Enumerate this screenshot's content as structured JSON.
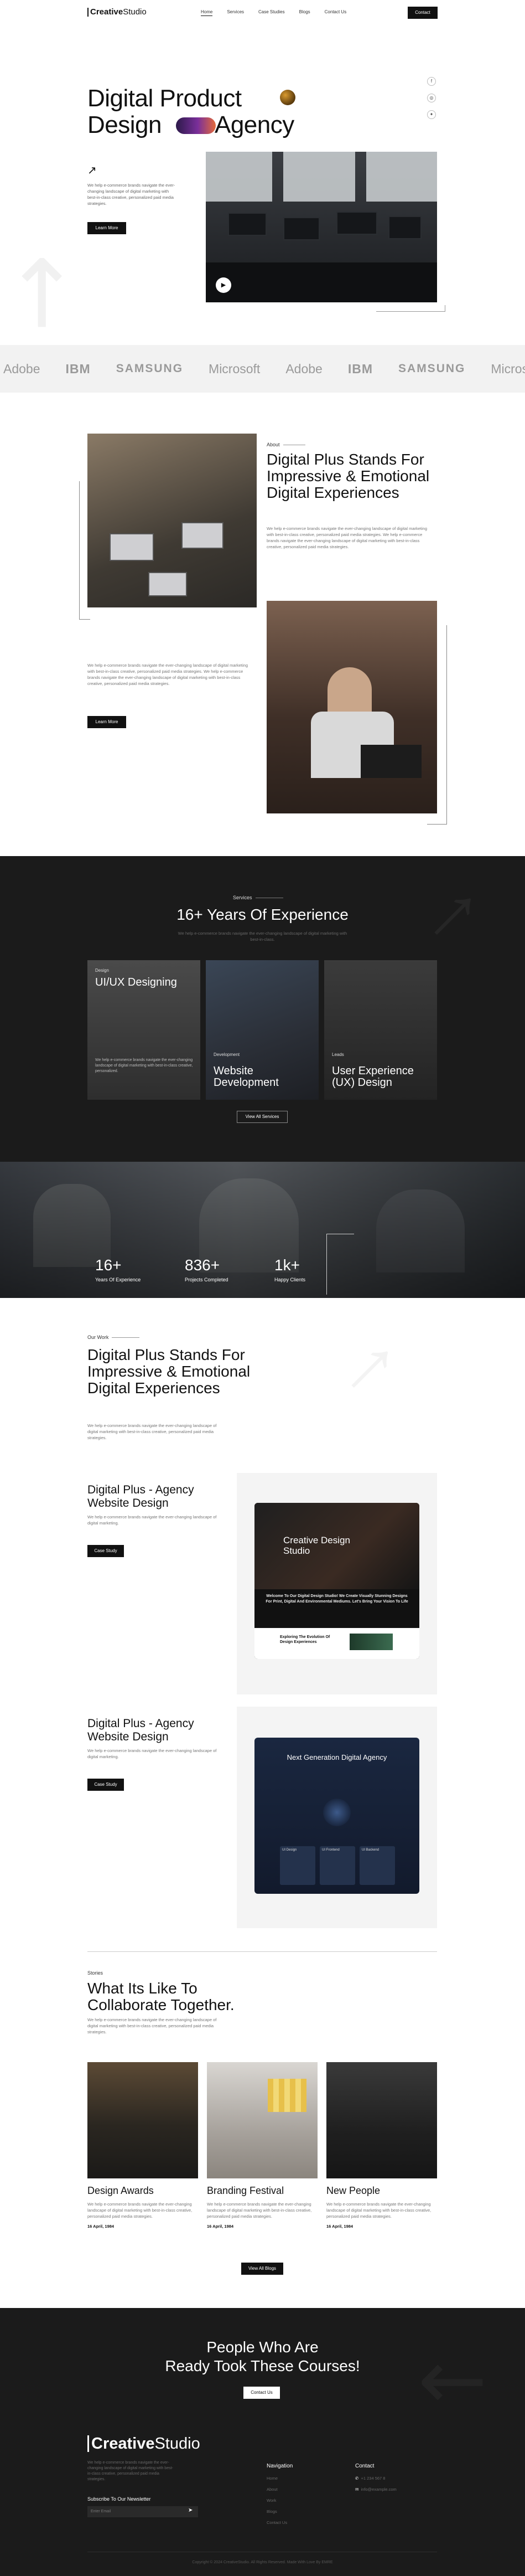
{
  "nav": {
    "logo_bold": "Creative",
    "logo_light": "Studio",
    "links": [
      "Home",
      "Services",
      "Case Studies",
      "Blogs",
      "Contact Us"
    ],
    "contact_button": "Contact"
  },
  "hero": {
    "title_line1": "Digital Product",
    "title_line2a": "Design",
    "title_line2b": "Agency",
    "lead": "We help e-commerce brands navigate the ever-changing landscape of digital marketing with best-in-class creative, personalized paid media strategies.",
    "learn_more": "Learn More",
    "social_icons": [
      "facebook-icon",
      "instagram-icon",
      "twitter-icon"
    ]
  },
  "logos": [
    "Adobe",
    "IBM",
    "SAMSUNG",
    "Microsoft",
    "Adobe",
    "IBM",
    "SAMSUNG",
    "Microsoft"
  ],
  "about": {
    "label": "About",
    "title": "Digital Plus Stands For Impressive & Emotional Digital Experiences",
    "para1": "We help e-commerce brands navigate the ever-changing landscape of digital marketing with best-in-class creative, personalized paid media strategies. We help e-commerce brands navigate the ever-changing landscape of digital marketing with best-in-class creative, personalized paid media strategies.",
    "para2": "We help e-commerce brands navigate the ever-changing landscape of digital marketing with best-in-class creative, personalized paid media strategies. We help e-commerce brands navigate the ever-changing landscape of digital marketing with best-in-class creative, personalized paid media strategies.",
    "learn_more": "Learn More"
  },
  "services": {
    "label": "Services",
    "title": "16+ Years Of Experience",
    "sub": "We help e-commerce brands navigate the ever-changing landscape of digital marketing with best-in-class.",
    "cards": [
      {
        "small": "Design",
        "title": "UI/UX Designing",
        "desc": "We help e-commerce brands navigate the ever-changing landscape of digital marketing with best-in-class creative, personalized."
      },
      {
        "small": "Development",
        "title": "Website Development"
      },
      {
        "small": "Leads",
        "title": "User Experience (UX) Design"
      }
    ],
    "view_all": "View All Services"
  },
  "stats": [
    {
      "number": "16+",
      "label": "Years Of Experience"
    },
    {
      "number": "836+",
      "label": "Projects Completed"
    },
    {
      "number": "1k+",
      "label": "Happy Clients"
    }
  ],
  "work": {
    "label": "Our Work",
    "title": "Digital Plus Stands For Impressive & Emotional Digital Experiences",
    "para": "We help e-commerce brands navigate the ever-changing landscape of digital marketing with best-in-class creative, personalized paid media strategies.",
    "projects": [
      {
        "title": "Digital Plus - Agency Website Design",
        "desc": "We help e-commerce brands navigate the ever-changing landscape of digital marketing.",
        "button": "Case Study",
        "mock_title": "Creative Design Studio",
        "mock_sub": "Welcome To Our Digital Design Studio! We Create Visually Stunning Designs For Print, Digital And Environmental Mediums. Let's Bring Your Vision To Life",
        "mock_bottom": "Exploring The Evolution Of Design Experiences"
      },
      {
        "title": "Digital Plus - Agency Website Design",
        "desc": "We help e-commerce brands navigate the ever-changing landscape of digital marketing.",
        "button": "Case Study",
        "mock_title": "Next Generation Digital Agency",
        "mock_cols": [
          "UI Design",
          "UI Frontend",
          "UI Backend"
        ]
      }
    ],
    "stories_label": "Stories",
    "stories_title": "What Its Like To Collaborate Together.",
    "stories_para": "We help e-commerce brands navigate the ever-changing landscape of digital marketing with best-in-class creative, personalized paid media strategies.",
    "blogs": [
      {
        "title": "Design Awards",
        "desc": "We help e-commerce brands navigate the ever-changing landscape of digital marketing with best-in-class creative, personalized paid media strategies.",
        "date": "16 April, 1984"
      },
      {
        "title": "Branding Festival",
        "desc": "We help e-commerce brands navigate the ever-changing landscape of digital marketing with best-in-class creative, personalized paid media strategies.",
        "date": "16 April, 1984"
      },
      {
        "title": "New People",
        "desc": "We help e-commerce brands navigate the ever-changing landscape of digital marketing with best-in-class creative, personalized paid media strategies.",
        "date": "16 April, 1984"
      }
    ],
    "view_blogs": "View All Blogs"
  },
  "cta": {
    "line1": "People Who Are",
    "line2": "Ready Took These Courses!",
    "button": "Contact Us"
  },
  "footer": {
    "logo_bold": "Creative",
    "logo_light": "Studio",
    "para": "We help e-commerce brands navigate the ever-changing landscape of digital marketing with best-in-class creative, personalized paid media strategies.",
    "subscribe": "Subscribe To Our Newsletter",
    "email_placeholder": "Enter Email",
    "nav_title": "Navigation",
    "nav_items": [
      "Home",
      "About",
      "Work",
      "Blogs",
      "Contact Us"
    ],
    "contact_title": "Contact",
    "phone": "+1 234 567 8",
    "email": "info@example.com",
    "copyright": "Copyright © 2024 CreativeStudio. All Rights Reserved. Made With Love By EMRE"
  }
}
